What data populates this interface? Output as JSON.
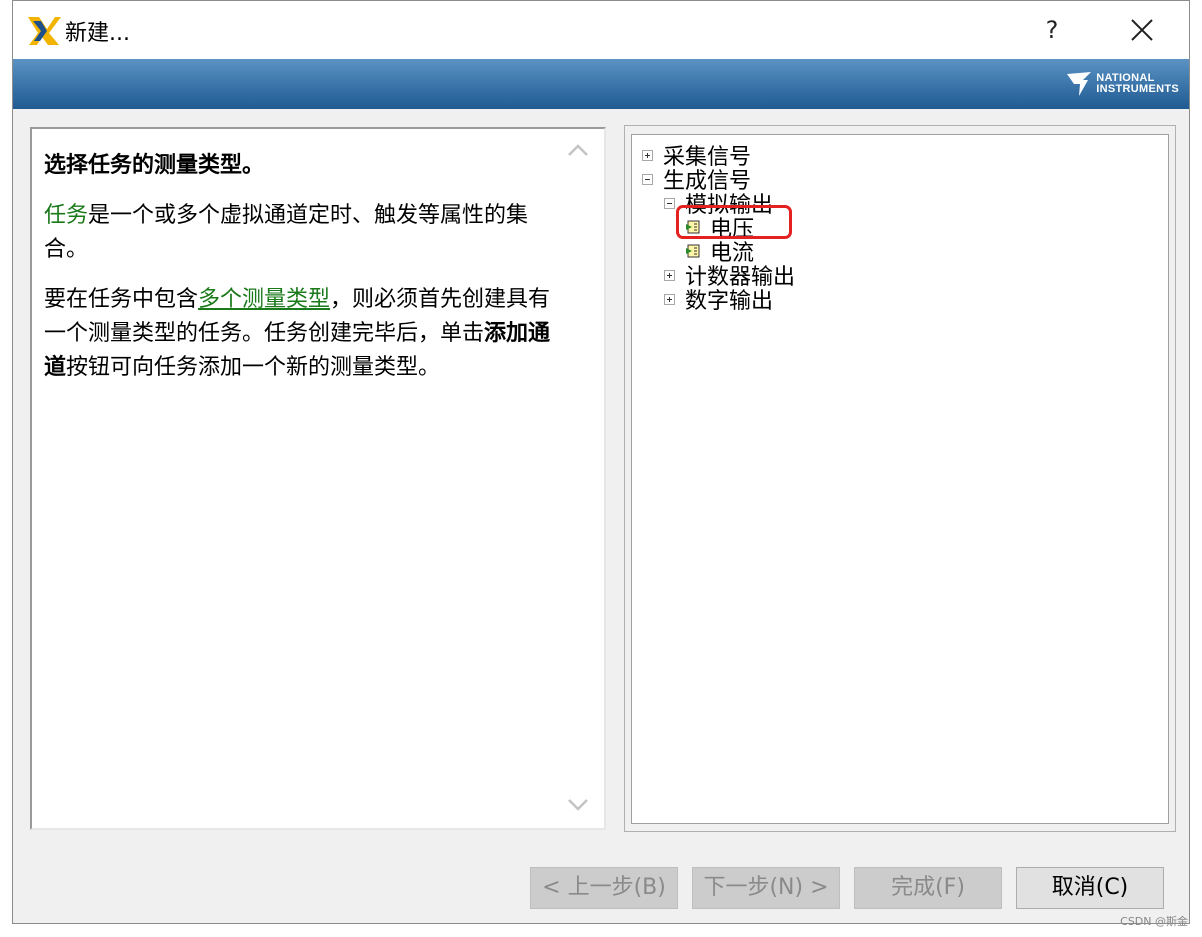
{
  "window": {
    "title": "新建...",
    "help_label": "?",
    "close_icon": "close-icon"
  },
  "banner": {
    "logo_line1": "NATIONAL",
    "logo_line2": "INSTRUMENTS"
  },
  "help": {
    "title": "选择任务的测量类型。",
    "p1_link": "任务",
    "p1_text": "是一个或多个虚拟通道定时、触发等属性的集合。",
    "p2_text1": "要在任务中包含",
    "p2_link": "多个测量类型",
    "p2_text2": "，则必须首先创建具有一个测量类型的任务。任务创建完毕后，单击",
    "p2_bold": "添加通道",
    "p2_text3": "按钮可向任务添加一个新的测量类型。"
  },
  "tree": {
    "items": [
      {
        "label": "采集信号",
        "state": "collapsed"
      },
      {
        "label": "生成信号",
        "state": "expanded"
      },
      {
        "label": "模拟输出",
        "state": "expanded"
      },
      {
        "label": "电压",
        "state": "leaf",
        "highlighted": true
      },
      {
        "label": "电流",
        "state": "leaf"
      },
      {
        "label": "计数器输出",
        "state": "collapsed"
      },
      {
        "label": "数字输出",
        "state": "collapsed"
      }
    ]
  },
  "buttons": {
    "back": "< 上一步(B)",
    "next": "下一步(N) >",
    "finish": "完成(F)",
    "cancel": "取消(C)"
  },
  "watermark": "CSDN @斯金"
}
